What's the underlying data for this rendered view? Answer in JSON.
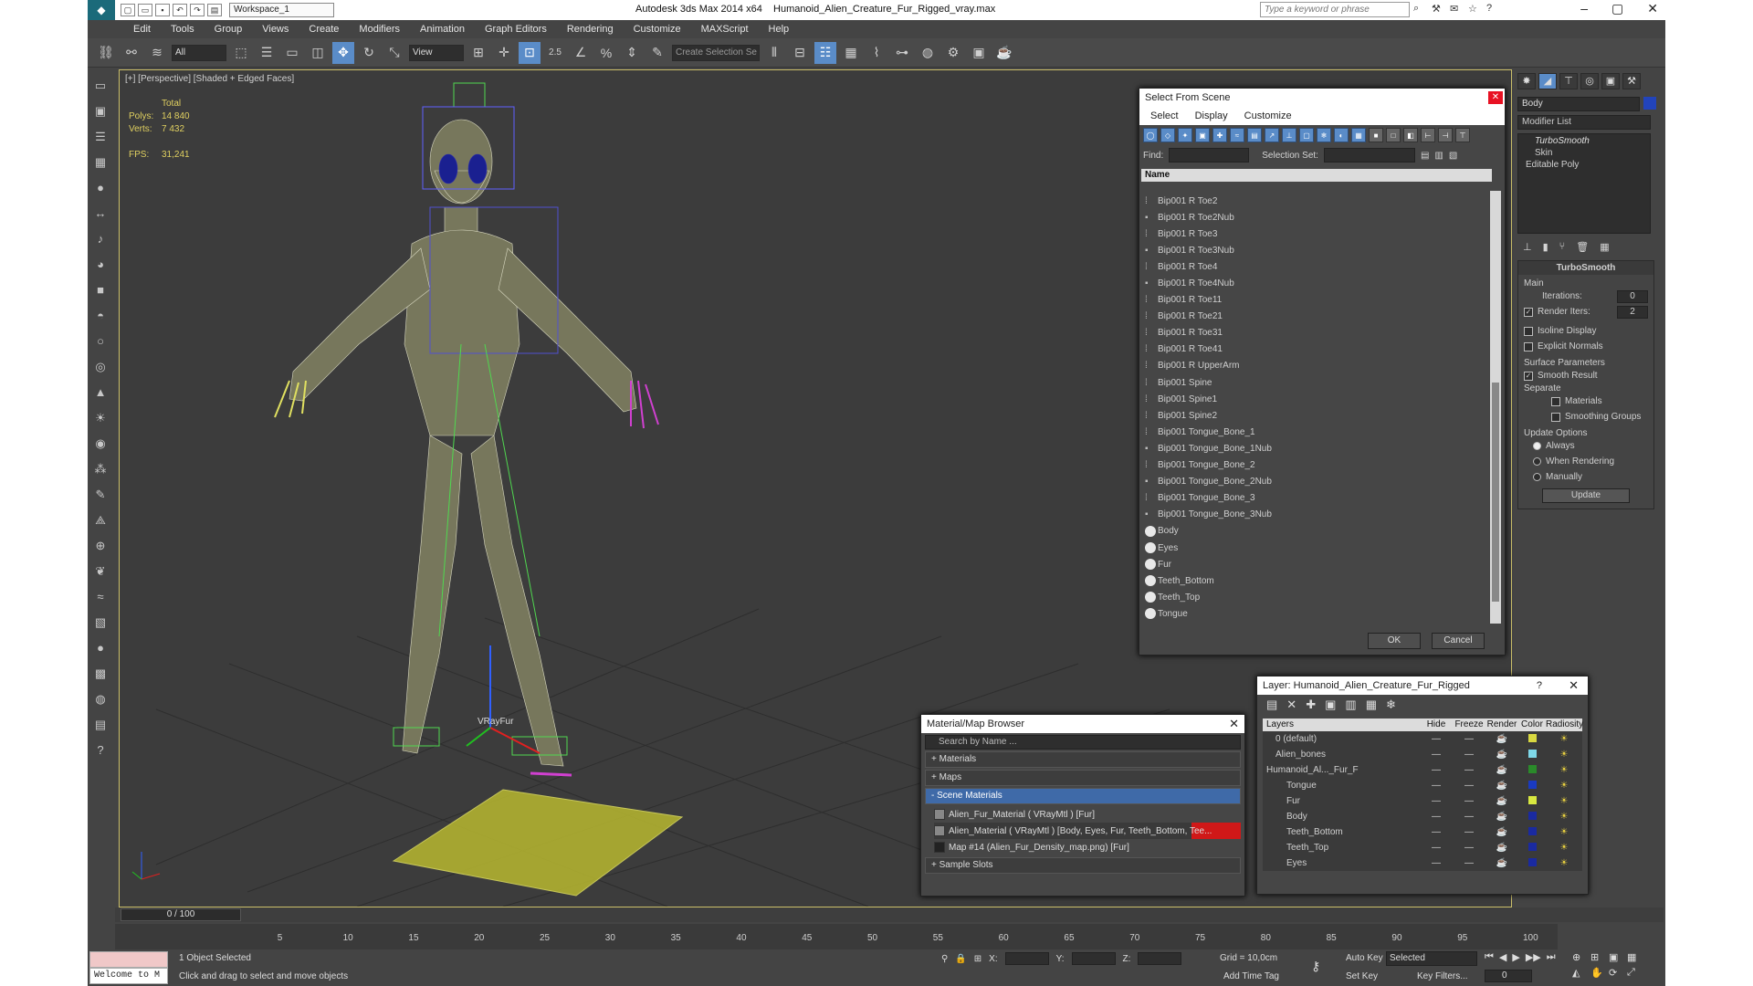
{
  "title": {
    "workspace": "Workspace_1",
    "app": "Autodesk 3ds Max  2014 x64",
    "file": "Humanoid_Alien_Creature_Fur_Rigged_vray.max",
    "search_placeholder": "Type a keyword or phrase"
  },
  "menu": [
    "Edit",
    "Tools",
    "Group",
    "Views",
    "Create",
    "Modifiers",
    "Animation",
    "Graph Editors",
    "Rendering",
    "Customize",
    "MAXScript",
    "Help"
  ],
  "toolbar": {
    "filter_value": "All",
    "coord_value": "View",
    "percent_label": "2.5",
    "named_sel_placeholder": "Create Selection Se"
  },
  "viewport": {
    "label": "[+] [Perspective] [Shaded + Edged Faces]",
    "stats": {
      "total_label": "Total",
      "polys_label": "Polys:",
      "polys_value": "14 840",
      "verts_label": "Verts:",
      "verts_value": "7 432",
      "fps_label": "FPS:",
      "fps_value": "31,241"
    },
    "gizmo_label": "VRayFur"
  },
  "select_from_scene": {
    "title": "Select From Scene",
    "menu": [
      "Select",
      "Display",
      "Customize"
    ],
    "find_label": "Find:",
    "selset_label": "Selection Set:",
    "column_name": "Name",
    "items": [
      {
        "name": "Bip001 R Toe2",
        "kind": "bone"
      },
      {
        "name": "Bip001 R Toe2Nub",
        "kind": "bone-nub"
      },
      {
        "name": "Bip001 R Toe3",
        "kind": "bone"
      },
      {
        "name": "Bip001 R Toe3Nub",
        "kind": "bone-nub"
      },
      {
        "name": "Bip001 R Toe4",
        "kind": "bone"
      },
      {
        "name": "Bip001 R Toe4Nub",
        "kind": "bone-nub"
      },
      {
        "name": "Bip001 R Toe11",
        "kind": "bone"
      },
      {
        "name": "Bip001 R Toe21",
        "kind": "bone"
      },
      {
        "name": "Bip001 R Toe31",
        "kind": "bone"
      },
      {
        "name": "Bip001 R Toe41",
        "kind": "bone"
      },
      {
        "name": "Bip001 R UpperArm",
        "kind": "bone"
      },
      {
        "name": "Bip001 Spine",
        "kind": "bone"
      },
      {
        "name": "Bip001 Spine1",
        "kind": "bone"
      },
      {
        "name": "Bip001 Spine2",
        "kind": "bone"
      },
      {
        "name": "Bip001 Tongue_Bone_1",
        "kind": "bone"
      },
      {
        "name": "Bip001 Tongue_Bone_1Nub",
        "kind": "bone-nub"
      },
      {
        "name": "Bip001 Tongue_Bone_2",
        "kind": "bone"
      },
      {
        "name": "Bip001 Tongue_Bone_2Nub",
        "kind": "bone-nub"
      },
      {
        "name": "Bip001 Tongue_Bone_3",
        "kind": "bone"
      },
      {
        "name": "Bip001 Tongue_Bone_3Nub",
        "kind": "bone-nub"
      },
      {
        "name": "Body",
        "kind": "object"
      },
      {
        "name": "Eyes",
        "kind": "object"
      },
      {
        "name": "Fur",
        "kind": "object"
      },
      {
        "name": "Teeth_Bottom",
        "kind": "object"
      },
      {
        "name": "Teeth_Top",
        "kind": "object"
      },
      {
        "name": "Tongue",
        "kind": "object"
      }
    ],
    "ok": "OK",
    "cancel": "Cancel"
  },
  "layers": {
    "title": "Layer: Humanoid_Alien_Creature_Fur_Rigged",
    "help": "?",
    "columns": [
      "Layers",
      "Hide",
      "Freeze",
      "Render",
      "Color",
      "Radiosity"
    ],
    "rows": [
      {
        "name": "0 (default)",
        "color": "#d8d840"
      },
      {
        "name": "Alien_bones",
        "color": "#7fd8e8"
      },
      {
        "name": "Humanoid_Al..._Fur_F",
        "color": "#2a8a2a"
      },
      {
        "name": "Tongue",
        "color": "#1a3ac0"
      },
      {
        "name": "Fur",
        "color": "#d8e840"
      },
      {
        "name": "Body",
        "color": "#1a2aa0"
      },
      {
        "name": "Teeth_Bottom",
        "color": "#1a2aa0"
      },
      {
        "name": "Teeth_Top",
        "color": "#1a2aa0"
      },
      {
        "name": "Eyes",
        "color": "#1a2aa0"
      }
    ],
    "hide_glyph": "—",
    "radiosity_glyph": "☀"
  },
  "material_browser": {
    "title": "Material/Map Browser",
    "search_placeholder": "Search by Name ...",
    "groups": [
      "+ Materials",
      "+ Maps",
      "- Scene Materials",
      "+ Sample Slots"
    ],
    "items": [
      "Alien_Fur_Material  ( VRayMtl ) [Fur]",
      "Alien_Material  ( VRayMtl ) [Body, Eyes, Fur, Teeth_Bottom, Tee...",
      "Map #14 (Alien_Fur_Density_map.png) [Fur]"
    ]
  },
  "command_panel": {
    "object_name": "Body",
    "modifier_list": "Modifier List",
    "stack": [
      "TurboSmooth",
      "Skin",
      "Editable Poly"
    ],
    "rollout_title": "TurboSmooth",
    "main_label": "Main",
    "iterations_label": "Iterations:",
    "iterations_value": "0",
    "render_iters_label": "Render Iters:",
    "render_iters_value": "2",
    "isoline": "Isoline Display",
    "explicit": "Explicit Normals",
    "surface_params": "Surface Parameters",
    "smooth_result": "Smooth Result",
    "separate": "Separate",
    "materials": "Materials",
    "smoothing_groups": "Smoothing Groups",
    "update_options": "Update Options",
    "always": "Always",
    "when_rendering": "When Rendering",
    "manually": "Manually",
    "update_btn": "Update"
  },
  "timeline": {
    "slider": "0 / 100",
    "ticks": [
      "0",
      "5",
      "10",
      "15",
      "20",
      "25",
      "30",
      "35",
      "40",
      "45",
      "50",
      "55",
      "60",
      "65",
      "70",
      "75",
      "80",
      "85",
      "90",
      "95",
      "100"
    ]
  },
  "status": {
    "welcome": "Welcome to M",
    "selected": "1 Object Selected",
    "prompt": "Click and drag to select and move objects",
    "x": "X:",
    "y": "Y:",
    "z": "Z:",
    "grid": "Grid = 10,0cm",
    "add_time_tag": "Add Time Tag",
    "auto_key": "Auto Key",
    "set_key": "Set Key",
    "selected_drop": "Selected",
    "key_filters": "Key Filters...",
    "frame": "0"
  }
}
